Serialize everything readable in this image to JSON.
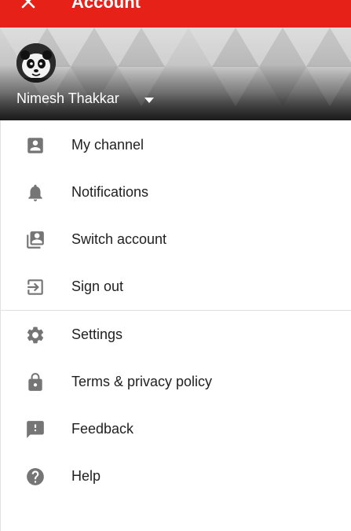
{
  "appbar": {
    "title": "Account",
    "close_icon": "close-icon",
    "color": "#e62117"
  },
  "account": {
    "name": "Nimesh Thakkar",
    "avatar_icon": "panda-avatar",
    "caret_icon": "caret-down-icon"
  },
  "menu": {
    "group1": [
      {
        "label": "My channel",
        "icon": "account-box-icon"
      },
      {
        "label": "Notifications",
        "icon": "bell-icon"
      },
      {
        "label": "Switch account",
        "icon": "switch-account-icon"
      },
      {
        "label": "Sign out",
        "icon": "exit-icon"
      }
    ],
    "group2": [
      {
        "label": "Settings",
        "icon": "gear-icon"
      },
      {
        "label": "Terms & privacy policy",
        "icon": "lock-icon"
      },
      {
        "label": "Feedback",
        "icon": "feedback-icon"
      },
      {
        "label": "Help",
        "icon": "help-icon"
      }
    ]
  },
  "colors": {
    "icon": "#757575",
    "text": "#212121",
    "divider": "#e0e0e0"
  }
}
